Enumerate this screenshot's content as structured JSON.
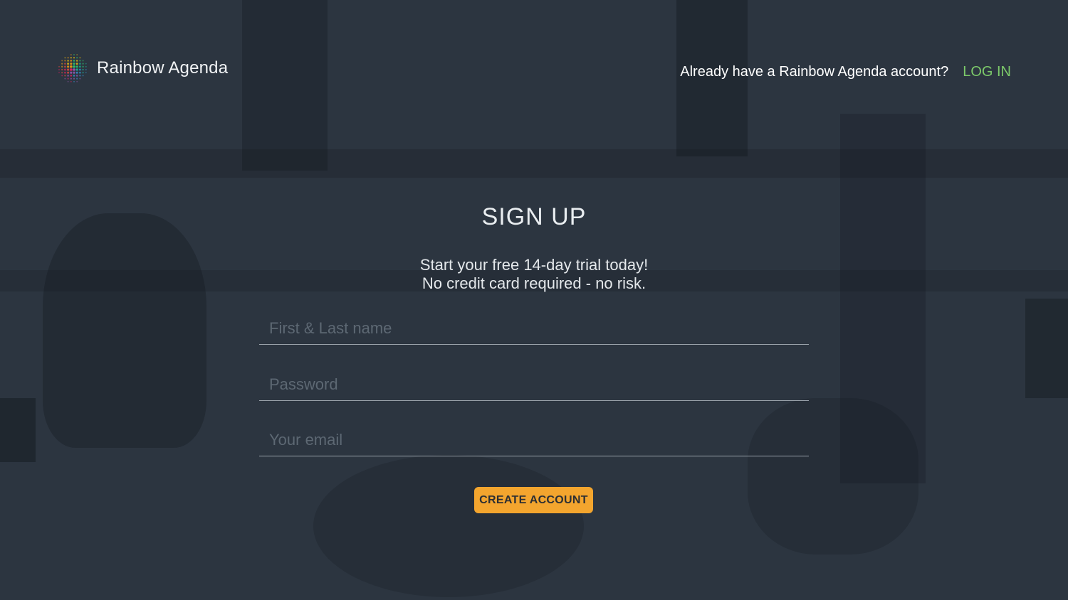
{
  "header": {
    "brand_name": "Rainbow Agenda",
    "logo_icon": "rainbow-dot-globe-icon",
    "login_prompt": "Already have a Rainbow Agenda account?",
    "login_link": "LOG IN"
  },
  "form": {
    "title": "SIGN UP",
    "subtitle_line1": "Start your free 14-day trial today!",
    "subtitle_line2": "No credit card required - no risk.",
    "name_placeholder": "First & Last name",
    "password_placeholder": "Password",
    "email_placeholder": "Your email",
    "submit_label": "CREATE ACCOUNT"
  },
  "colors": {
    "background": "#2c3540",
    "accent_link": "#7cc96a",
    "button": "#f3a52e"
  }
}
